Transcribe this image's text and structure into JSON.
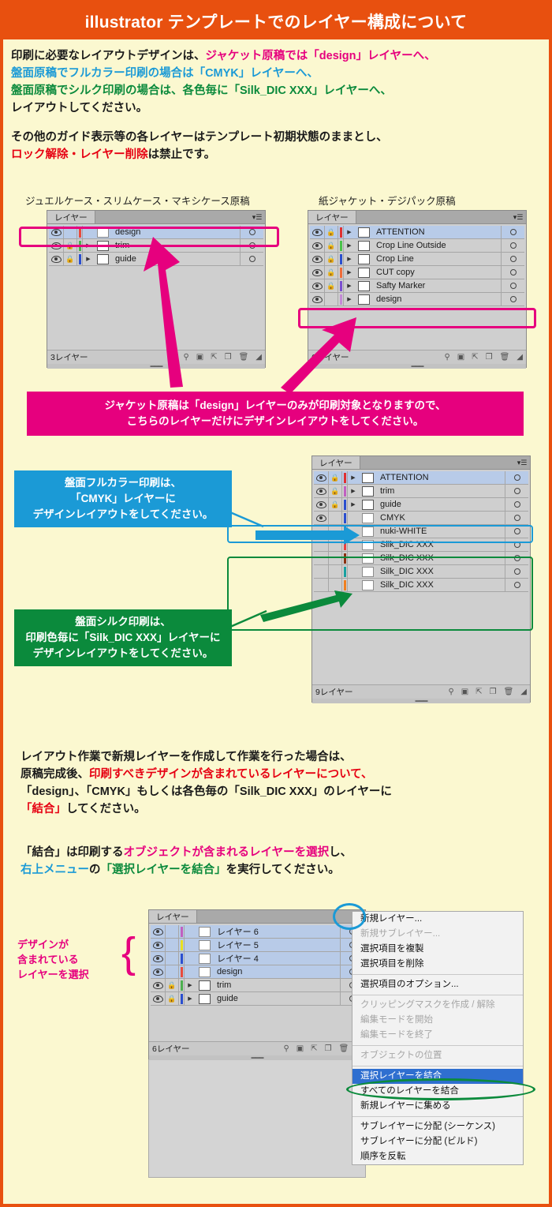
{
  "header": {
    "title": "illustrator テンプレートでのレイヤー構成について"
  },
  "intro": {
    "line1_a": "印刷に必要なレイアウトデザインは、",
    "line1_b": "ジャケット原稿では「design」レイヤーへ、",
    "line2": "盤面原稿でフルカラー印刷の場合は「CMYK」レイヤーへ、",
    "line3": "盤面原稿でシルク印刷の場合は、各色毎に「Silk_DIC XXX」レイヤーへ、",
    "line4": "レイアウトしてください。",
    "line5": "その他のガイド表示等の各レイヤーはテンプレート初期状態のままとし、",
    "line6_a": "ロック解除・レイヤー削除",
    "line6_b": "は禁止です。"
  },
  "captions": {
    "left_panel": "ジュエルケース・スリムケース・マキシケース原稿",
    "right_panel": "紙ジャケット・デジパック原稿"
  },
  "panel_tab_label": "レイヤー",
  "panel1": {
    "count_label": "3レイヤー",
    "layers": [
      {
        "name": "design",
        "visible": true,
        "locked": false,
        "selected": true,
        "strip": "#e84b3c",
        "has_arrow": false
      },
      {
        "name": "trim",
        "visible": true,
        "locked": true,
        "selected": false,
        "strip": "#4caf50",
        "has_arrow": true
      },
      {
        "name": "guide",
        "visible": true,
        "locked": true,
        "selected": false,
        "strip": "#2b4fcf",
        "has_arrow": true
      }
    ]
  },
  "panel2": {
    "count_label": "6レイヤー",
    "layers": [
      {
        "name": "ATTENTION",
        "visible": true,
        "locked": true,
        "selected": true,
        "strip": "#e03030",
        "has_arrow": true
      },
      {
        "name": "Crop Line Outside",
        "visible": true,
        "locked": true,
        "selected": false,
        "strip": "#49c24a",
        "has_arrow": true
      },
      {
        "name": "Crop Line",
        "visible": true,
        "locked": true,
        "selected": false,
        "strip": "#2b4fcf",
        "has_arrow": true
      },
      {
        "name": "CUT copy",
        "visible": true,
        "locked": true,
        "selected": false,
        "strip": "#ef6c3a",
        "has_arrow": true
      },
      {
        "name": "Safty Marker",
        "visible": true,
        "locked": true,
        "selected": false,
        "strip": "#7b4fd0",
        "has_arrow": true
      },
      {
        "name": "design",
        "visible": true,
        "locked": false,
        "selected": false,
        "strip": "#c48ad6",
        "has_arrow": true
      }
    ]
  },
  "panel3": {
    "count_label": "9レイヤー",
    "layers": [
      {
        "name": "ATTENTION",
        "visible": true,
        "locked": true,
        "selected": true,
        "strip": "#e03030",
        "has_arrow": true
      },
      {
        "name": "trim",
        "visible": true,
        "locked": true,
        "selected": false,
        "strip": "#c060c0",
        "has_arrow": true
      },
      {
        "name": "guide",
        "visible": true,
        "locked": true,
        "selected": false,
        "strip": "#2b4fcf",
        "has_arrow": true
      },
      {
        "name": "CMYK",
        "visible": true,
        "locked": false,
        "selected": false,
        "strip": "#2b4fcf",
        "has_arrow": false
      },
      {
        "name": "nuki-WHITE",
        "visible": false,
        "locked": false,
        "selected": false,
        "strip": "#5b2fbf",
        "has_arrow": false
      },
      {
        "name": "Silk_DIC XXX",
        "visible": false,
        "locked": false,
        "selected": false,
        "strip": "#e84040",
        "has_arrow": false
      },
      {
        "name": "Silk_DIC XXX",
        "visible": false,
        "locked": false,
        "selected": false,
        "strip": "#8a3010",
        "has_arrow": false
      },
      {
        "name": "Silk_DIC XXX",
        "visible": false,
        "locked": false,
        "selected": false,
        "strip": "#18a0a0",
        "has_arrow": false
      },
      {
        "name": "Silk_DIC XXX",
        "visible": false,
        "locked": false,
        "selected": false,
        "strip": "#f08020",
        "has_arrow": false
      }
    ]
  },
  "panel4": {
    "count_label": "6レイヤー",
    "layers": [
      {
        "name": "レイヤー 6",
        "visible": true,
        "locked": false,
        "selected": true,
        "strip": "#c060c0",
        "has_arrow": false
      },
      {
        "name": "レイヤー 5",
        "visible": true,
        "locked": false,
        "selected": true,
        "strip": "#e8e020",
        "has_arrow": false
      },
      {
        "name": "レイヤー 4",
        "visible": true,
        "locked": false,
        "selected": true,
        "strip": "#2b4fcf",
        "has_arrow": false
      },
      {
        "name": "design",
        "visible": true,
        "locked": false,
        "selected": true,
        "strip": "#e84b3c",
        "has_arrow": false
      },
      {
        "name": "trim",
        "visible": true,
        "locked": true,
        "selected": false,
        "strip": "#4caf50",
        "has_arrow": true
      },
      {
        "name": "guide",
        "visible": true,
        "locked": true,
        "selected": false,
        "strip": "#2b4fcf",
        "has_arrow": true
      }
    ]
  },
  "callouts": {
    "pink1_line1": "ジャケット原稿は「design」レイヤーのみが印刷対象となりますので、",
    "pink1_line2": "こちらのレイヤーだけにデザインレイアウトをしてください。",
    "blue_line1": "盤面フルカラー印刷は、",
    "blue_line2": "「CMYK」レイヤーに",
    "blue_line3": "デザインレイアウトをしてください。",
    "green_line1": "盤面シルク印刷は、",
    "green_line2": "印刷色毎に「Silk_DIC XXX」レイヤーに",
    "green_line3": "デザインレイアウトをしてください。"
  },
  "lower": {
    "p1_line1": "レイアウト作業で新規レイヤーを作成して作業を行った場合は、",
    "p1_line2_a": "原稿完成後、",
    "p1_line2_b": "印刷すべきデザインが含まれているレイヤーについて、",
    "p1_line3": "「design」、「CMYK」もしくは各色毎の「Silk_DIC XXX」のレイヤーに",
    "p1_line4_a": "「結合」",
    "p1_line4_b": "してください。",
    "p2_line1_a": "「結合」は印刷する",
    "p2_line1_b": "オブジェクトが含まれるレイヤーを選択",
    "p2_line1_c": "し、",
    "p2_line2_a": "右上メニュー",
    "p2_line2_b": "の",
    "p2_line2_c": "「選択レイヤーを結合」",
    "p2_line2_d": "を実行してください。"
  },
  "select_label": {
    "line1": "デザインが",
    "line2": "含まれている",
    "line3": "レイヤーを選択"
  },
  "context_menu": {
    "items": [
      {
        "label": "新規レイヤー...",
        "state": "normal"
      },
      {
        "label": "新規サブレイヤー...",
        "state": "disabled"
      },
      {
        "label": "選択項目を複製",
        "state": "normal"
      },
      {
        "label": "選択項目を削除",
        "state": "normal"
      },
      {
        "label": "__sep__",
        "state": "sep"
      },
      {
        "label": "選択項目のオプション...",
        "state": "normal"
      },
      {
        "label": "__sep__",
        "state": "sep"
      },
      {
        "label": "クリッピングマスクを作成 / 解除",
        "state": "disabled"
      },
      {
        "label": "編集モードを開始",
        "state": "disabled"
      },
      {
        "label": "編集モードを終了",
        "state": "disabled"
      },
      {
        "label": "__sep__",
        "state": "sep"
      },
      {
        "label": "オブジェクトの位置",
        "state": "disabled"
      },
      {
        "label": "__sep__",
        "state": "sep"
      },
      {
        "label": "選択レイヤーを結合",
        "state": "selected"
      },
      {
        "label": "すべてのレイヤーを結合",
        "state": "normal"
      },
      {
        "label": "新規レイヤーに集める",
        "state": "normal"
      },
      {
        "label": "__sep__",
        "state": "sep"
      },
      {
        "label": "サブレイヤーに分配 (シーケンス)",
        "state": "normal"
      },
      {
        "label": "サブレイヤーに分配 (ビルド)",
        "state": "normal"
      },
      {
        "label": "順序を反転",
        "state": "normal"
      }
    ]
  },
  "colors": {
    "header_bg": "#e8500f",
    "page_bg": "#fbf8d0",
    "pink": "#e6007e",
    "blue": "#1b9ad6",
    "green": "#0b8a3c",
    "red": "#e60012"
  }
}
